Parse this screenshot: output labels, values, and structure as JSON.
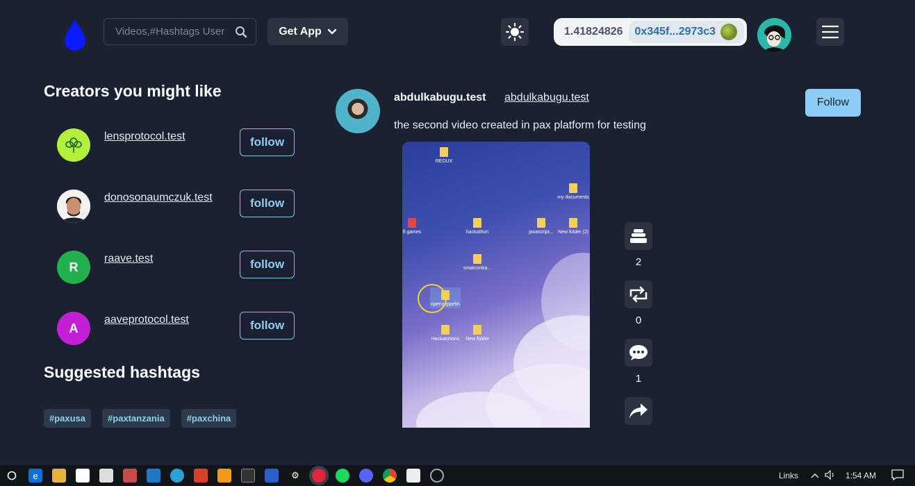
{
  "header": {
    "search_placeholder": "Videos,#Hashtags User",
    "get_app_label": "Get App",
    "wallet_balance": "1.41824826",
    "wallet_address": "0x345f...2973c3"
  },
  "creators_section": {
    "title": "Creators you might like",
    "follow_label": "follow",
    "items": [
      {
        "name": "lensprotocol.test",
        "initial": "",
        "color": "#b2f03a"
      },
      {
        "name": "donosonaumczuk.test",
        "initial": "",
        "color": "#f2f2f2"
      },
      {
        "name": "raave.test",
        "initial": "R",
        "color": "#22b14c"
      },
      {
        "name": "aaveprotocol.test",
        "initial": "A",
        "color": "#c21fd6"
      }
    ]
  },
  "hashtags_section": {
    "title": "Suggested hashtags",
    "tags": [
      "#paxusa",
      "#paxtanzania",
      "#paxchina"
    ]
  },
  "post": {
    "display_name": "abdulkabugu.test",
    "handle": "abdulkabugu.test",
    "description": "the second video created in pax platform for testing",
    "follow_label": "Follow",
    "desktop_icons": [
      "REDUX",
      "my documents",
      "ft games",
      "hackathon",
      "javascript...",
      "New folder (2)",
      "smatcontra...",
      "openzeppelin",
      "Hackatohons",
      "New folder"
    ],
    "actions": {
      "collect_count": "2",
      "mirror_count": "0",
      "comment_count": "1"
    }
  },
  "taskbar": {
    "links_label": "Links",
    "time": "1:54 AM"
  },
  "colors": {
    "background": "#1a2130",
    "accent": "#8ccdf6",
    "button_bg": "#2b3240"
  }
}
